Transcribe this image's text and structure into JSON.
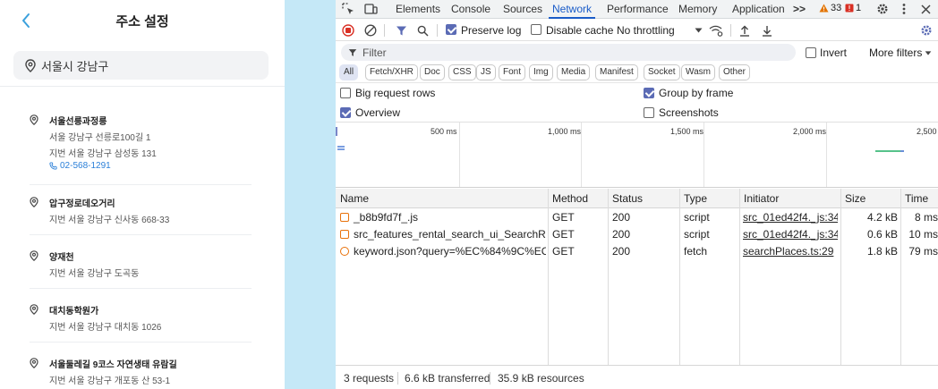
{
  "app": {
    "title": "주소 설정",
    "search_value": "서울시 강남구",
    "places": [
      {
        "name": "서울선릉과정릉",
        "lines": [
          "서울 강남구 선릉로100길 1",
          "지번 서울 강남구 삼성동 131"
        ],
        "phone": "02-568-1291"
      },
      {
        "name": "압구정로데오거리",
        "lines": [
          "지번 서울 강남구 신사동 668-33"
        ]
      },
      {
        "name": "양재천",
        "lines": [
          "지번 서울 강남구 도곡동"
        ]
      },
      {
        "name": "대치동학원가",
        "lines": [
          "지번 서울 강남구 대치동 1026"
        ]
      },
      {
        "name": "서울둘레길 9코스 자연생태 유람길",
        "lines": [
          "지번 서울 강남구 개포동 산 53-1"
        ]
      }
    ]
  },
  "devtools": {
    "tabs": [
      "Elements",
      "Console",
      "Sources",
      "Network",
      "Performance",
      "Memory",
      "Application"
    ],
    "active_tab": "Network",
    "more_tabs": ">>",
    "warnings_count": "33",
    "errors_count": "1",
    "toolbar": {
      "preserve_log": "Preserve log",
      "disable_cache": "Disable cache",
      "throttling": "No throttling"
    },
    "filter": {
      "placeholder": "Filter",
      "invert": "Invert",
      "more_filters": "More filters"
    },
    "type_filters": [
      "All",
      "Fetch/XHR",
      "Doc",
      "CSS",
      "JS",
      "Font",
      "Img",
      "Media",
      "Manifest",
      "Socket",
      "Wasm",
      "Other"
    ],
    "options": {
      "big_request_rows": "Big request rows",
      "group_by_frame": "Group by frame",
      "overview": "Overview",
      "screenshots": "Screenshots"
    },
    "overview_ticks": [
      "500 ms",
      "1,000 ms",
      "1,500 ms",
      "2,000 ms",
      "2,500"
    ],
    "columns": [
      "Name",
      "Method",
      "Status",
      "Type",
      "Initiator",
      "Size",
      "Time"
    ],
    "requests": [
      {
        "name": "_b8b9fd7f_.js",
        "method": "GET",
        "status": "200",
        "type": "script",
        "initiator": "src_01ed42f4._js:34",
        "size": "4.2 kB",
        "time": "8 ms"
      },
      {
        "name": "src_features_rental_search_ui_SearchResult...",
        "method": "GET",
        "status": "200",
        "type": "script",
        "initiator": "src_01ed42f4._js:34",
        "size": "0.6 kB",
        "time": "10 ms"
      },
      {
        "name": "keyword.json?query=%EC%84%9C%EC%9...",
        "method": "GET",
        "status": "200",
        "type": "fetch",
        "initiator": "searchPlaces.ts:29",
        "size": "1.8 kB",
        "time": "79 ms"
      }
    ],
    "status": {
      "requests": "3 requests",
      "transferred": "6.6 kB transferred",
      "resources": "35.9 kB resources"
    },
    "colors": {
      "accent": "#1a5cc8",
      "checkbox": "#5b6bb5",
      "record": "#d93025"
    }
  }
}
